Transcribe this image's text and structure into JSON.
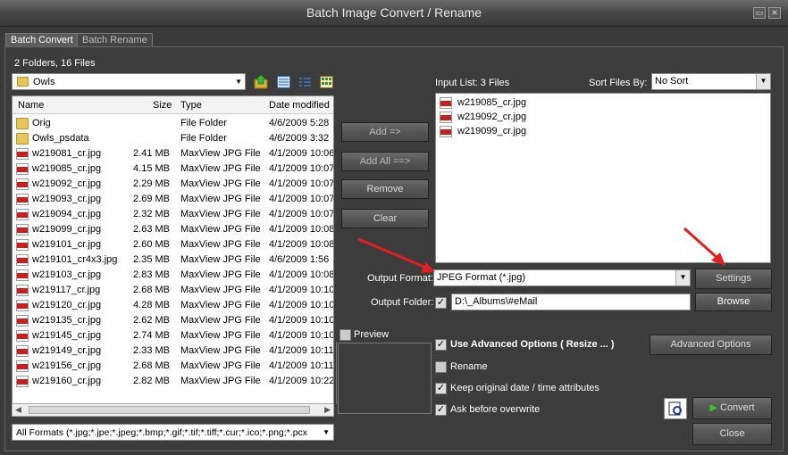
{
  "window": {
    "title": "Batch Image Convert / Rename"
  },
  "tabs": [
    "Batch Convert",
    "Batch Rename"
  ],
  "summary": "2 Folders, 16 Files",
  "folder": {
    "current": "Owls"
  },
  "columns": {
    "name": "Name",
    "size": "Size",
    "type": "Type",
    "date": "Date modified"
  },
  "files": [
    {
      "name": "Orig",
      "size": "",
      "type": "File Folder",
      "date": "4/6/2009 5:28",
      "kind": "folder"
    },
    {
      "name": "Owls_psdata",
      "size": "",
      "type": "File Folder",
      "date": "4/6/2009 3:32",
      "kind": "folder"
    },
    {
      "name": "w219081_cr.jpg",
      "size": "2.41 MB",
      "type": "MaxView JPG File",
      "date": "4/1/2009 10:06",
      "kind": "jpg"
    },
    {
      "name": "w219085_cr.jpg",
      "size": "4.15 MB",
      "type": "MaxView JPG File",
      "date": "4/1/2009 10:07",
      "kind": "jpg"
    },
    {
      "name": "w219092_cr.jpg",
      "size": "2.29 MB",
      "type": "MaxView JPG File",
      "date": "4/1/2009 10:07",
      "kind": "jpg"
    },
    {
      "name": "w219093_cr.jpg",
      "size": "2.69 MB",
      "type": "MaxView JPG File",
      "date": "4/1/2009 10:07",
      "kind": "jpg"
    },
    {
      "name": "w219094_cr.jpg",
      "size": "2.32 MB",
      "type": "MaxView JPG File",
      "date": "4/1/2009 10:07",
      "kind": "jpg"
    },
    {
      "name": "w219099_cr.jpg",
      "size": "2.63 MB",
      "type": "MaxView JPG File",
      "date": "4/1/2009 10:08",
      "kind": "jpg"
    },
    {
      "name": "w219101_cr.jpg",
      "size": "2.60 MB",
      "type": "MaxView JPG File",
      "date": "4/1/2009 10:08",
      "kind": "jpg"
    },
    {
      "name": "w219101_cr4x3.jpg",
      "size": "2.35 MB",
      "type": "MaxView JPG File",
      "date": "4/6/2009 1:56",
      "kind": "jpg"
    },
    {
      "name": "w219103_cr.jpg",
      "size": "2.83 MB",
      "type": "MaxView JPG File",
      "date": "4/1/2009 10:08",
      "kind": "jpg"
    },
    {
      "name": "w219117_cr.jpg",
      "size": "2.68 MB",
      "type": "MaxView JPG File",
      "date": "4/1/2009 10:10",
      "kind": "jpg"
    },
    {
      "name": "w219120_cr.jpg",
      "size": "4.28 MB",
      "type": "MaxView JPG File",
      "date": "4/1/2009 10:10",
      "kind": "jpg"
    },
    {
      "name": "w219135_cr.jpg",
      "size": "2.62 MB",
      "type": "MaxView JPG File",
      "date": "4/1/2009 10:10",
      "kind": "jpg"
    },
    {
      "name": "w219145_cr.jpg",
      "size": "2.74 MB",
      "type": "MaxView JPG File",
      "date": "4/1/2009 10:10",
      "kind": "jpg"
    },
    {
      "name": "w219149_cr.jpg",
      "size": "2.33 MB",
      "type": "MaxView JPG File",
      "date": "4/1/2009 10:11",
      "kind": "jpg"
    },
    {
      "name": "w219156_cr.jpg",
      "size": "2.68 MB",
      "type": "MaxView JPG File",
      "date": "4/1/2009 10:11",
      "kind": "jpg"
    },
    {
      "name": "w219160_cr.jpg",
      "size": "2.82 MB",
      "type": "MaxView JPG File",
      "date": "4/1/2009 10:22",
      "kind": "jpg"
    }
  ],
  "format_filter": "All Formats (*.jpg;*.jpe;*.jpeg;*.bmp;*.gif;*.tif;*.tiff;*.cur;*.ico;*.png;*.pcx",
  "buttons": {
    "add": "Add =>",
    "add_all": "Add All ==>",
    "remove": "Remove",
    "clear": "Clear",
    "settings": "Settings",
    "browse": "Browse",
    "advanced": "Advanced Options",
    "convert": "Convert",
    "close": "Close"
  },
  "input_list": {
    "label": "Input List:",
    "count": "3 Files",
    "sort_label": "Sort Files By:",
    "sort_value": "No Sort",
    "items": [
      "w219085_cr.jpg",
      "w219092_cr.jpg",
      "w219099_cr.jpg"
    ]
  },
  "output": {
    "format_label": "Output Format:",
    "format_value": "JPEG Format (*.jpg)",
    "folder_label": "Output Folder:",
    "folder_value": "D:\\_Albums\\#eMail"
  },
  "preview_label": "Preview",
  "options": {
    "advanced": "Use Advanced Options ( Resize ... )",
    "rename": "Rename",
    "keep_date": "Keep original date / time attributes",
    "ask_overwrite": "Ask before overwrite"
  },
  "icon_names": [
    "folder-up-icon",
    "view-details-icon",
    "view-list-icon",
    "view-thumbnails-icon",
    "jpg-file-icon",
    "folder-icon",
    "play-icon",
    "preview-icon",
    "red-arrow"
  ],
  "colors": {
    "accent_arrow": "#e02020",
    "background": "#3c3c3c"
  }
}
